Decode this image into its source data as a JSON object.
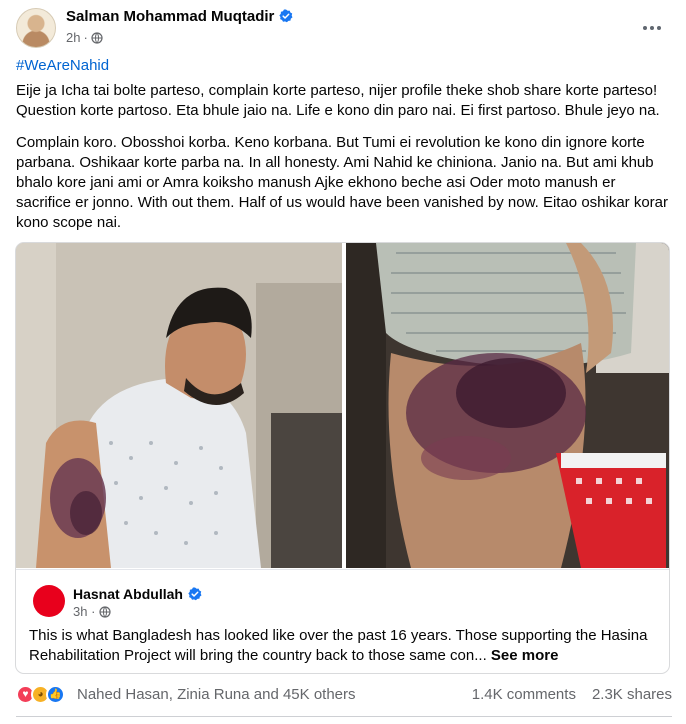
{
  "post": {
    "author": "Salman Mohammad Muqtadir",
    "time": "2h",
    "hashtag": "#WeAreNahid",
    "paragraph1": "Eije ja Icha tai bolte parteso, complain korte parteso,  nijer profile theke shob share korte parteso! Question korte partoso. Eta bhule jaio na.  Life e kono din paro nai. Ei first partoso. Bhule jeyo na.",
    "paragraph2": "Complain koro. Obosshoi korba. Keno korbana. But Tumi ei revolution ke kono din ignore korte parbana. Oshikaar korte parba na. In all honesty. Ami Nahid ke chiniona. Janio na. But ami khub bhalo kore jani ami or Amra koiksho manush Ajke ekhono beche asi Oder moto manush er sacrifice er jonno. With out them.  Half of us would have been vanished by now. Eitao oshikar korar kono scope nai."
  },
  "shared": {
    "author": "Hasnat Abdullah",
    "time": "3h",
    "text": "This is what Bangladesh has looked like over the past 16 years. Those supporting the Hasina Rehabilitation Project will bring the country back to those same con...",
    "see_more": "See more"
  },
  "stats": {
    "reactors": "Nahed Hasan, Zinia Runa and 45K others",
    "comments": "1.4K comments",
    "shares": "2.3K shares"
  },
  "colors": {
    "link_blue": "#0064d1",
    "verified_blue": "#1877f2",
    "secondary_text": "#65676b"
  }
}
